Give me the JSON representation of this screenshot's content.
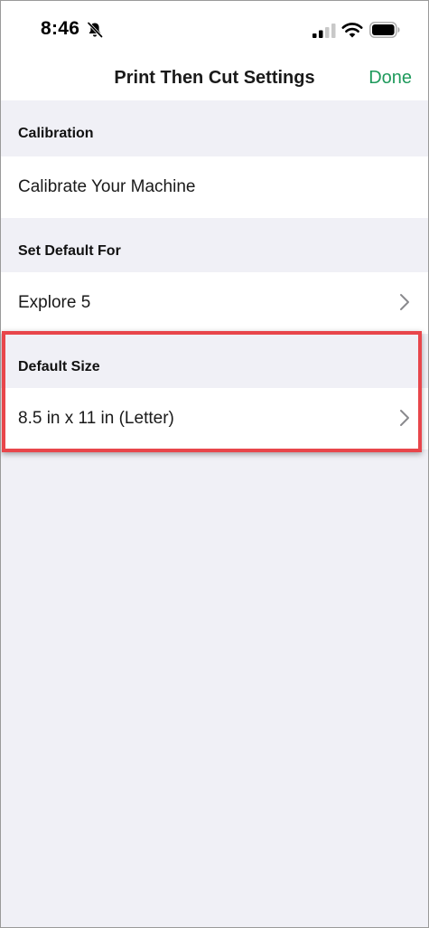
{
  "status_bar": {
    "time": "8:46",
    "icons": [
      "bell-slash-icon",
      "cellular-signal-icon",
      "wifi-icon",
      "battery-icon"
    ]
  },
  "nav": {
    "title": "Print Then Cut Settings",
    "done_label": "Done"
  },
  "sections": [
    {
      "header": "Calibration",
      "row": {
        "label": "Calibrate Your Machine",
        "has_chevron": false
      }
    },
    {
      "header": "Set Default For",
      "row": {
        "label": "Explore 5",
        "has_chevron": true
      }
    },
    {
      "header": "Default Size",
      "row": {
        "label": "8.5 in x 11 in (Letter)",
        "has_chevron": true
      },
      "highlighted": true
    }
  ],
  "colors": {
    "accent": "#1f9a5c",
    "highlight_border": "#e8464b",
    "grouped_background": "#f0f0f6"
  }
}
